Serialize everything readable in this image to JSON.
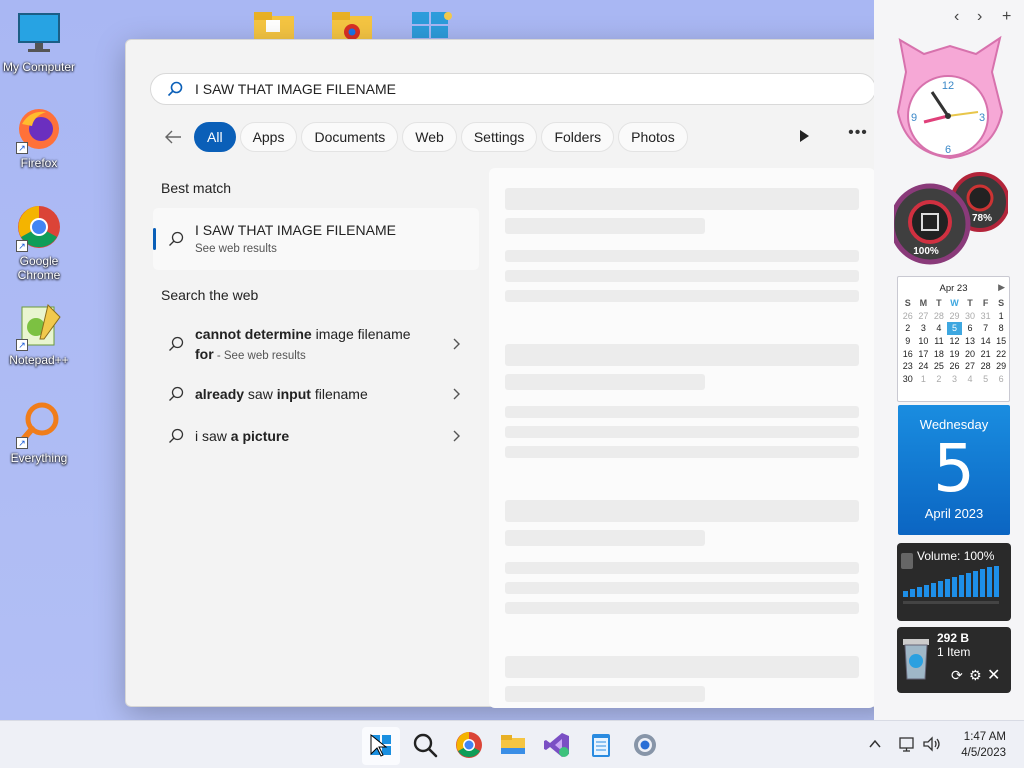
{
  "desktop": {
    "icons": [
      {
        "label": "My Computer"
      },
      {
        "label": "Firefox"
      },
      {
        "label": "Google Chrome"
      },
      {
        "label": "Notepad++"
      },
      {
        "label": "Everything"
      }
    ]
  },
  "search": {
    "query": "I SAW THAT IMAGE FILENAME",
    "filters": [
      "All",
      "Apps",
      "Documents",
      "Web",
      "Settings",
      "Folders",
      "Photos"
    ],
    "active_filter": "All",
    "best_match_title": "Best match",
    "best_match": {
      "title": "I SAW THAT IMAGE FILENAME",
      "subtitle": "See web results"
    },
    "web_title": "Search the web",
    "web_results": [
      {
        "bold1": "cannot determine",
        "normal1": " image filename",
        "bold2": "for",
        "sub": " - See web results"
      },
      {
        "bold1": "already",
        "normal1": " saw ",
        "bold2": "input",
        "normal2": " filename"
      },
      {
        "normal1": "i saw ",
        "bold1": "a picture"
      }
    ]
  },
  "widgets": {
    "clock_numbers": [
      "12",
      "3",
      "6",
      "9"
    ],
    "gauge_cpu": "100%",
    "gauge_ram": "78%",
    "calendar": {
      "month": "Apr 23",
      "weekdays": [
        "S",
        "M",
        "T",
        "W",
        "T",
        "F",
        "S"
      ],
      "weeks": [
        [
          "26",
          "27",
          "28",
          "29",
          "30",
          "31",
          "1"
        ],
        [
          "2",
          "3",
          "4",
          "5",
          "6",
          "7",
          "8"
        ],
        [
          "9",
          "10",
          "11",
          "12",
          "13",
          "14",
          "15"
        ],
        [
          "16",
          "17",
          "18",
          "19",
          "20",
          "21",
          "22"
        ],
        [
          "23",
          "24",
          "25",
          "26",
          "27",
          "28",
          "29"
        ],
        [
          "30",
          "1",
          "2",
          "3",
          "4",
          "5",
          "6"
        ]
      ]
    },
    "date": {
      "weekday": "Wednesday",
      "day": "5",
      "month_year": "April 2023"
    },
    "volume": {
      "label": "Volume: 100%",
      "level": 1.0
    },
    "recycle": {
      "size": "292 B",
      "items": "1 Item"
    }
  },
  "taskbar": {
    "time": "1:47 AM",
    "date": "4/5/2023"
  },
  "colors": {
    "accent": "#0a5fb8",
    "panel": "#f3f3f3"
  }
}
